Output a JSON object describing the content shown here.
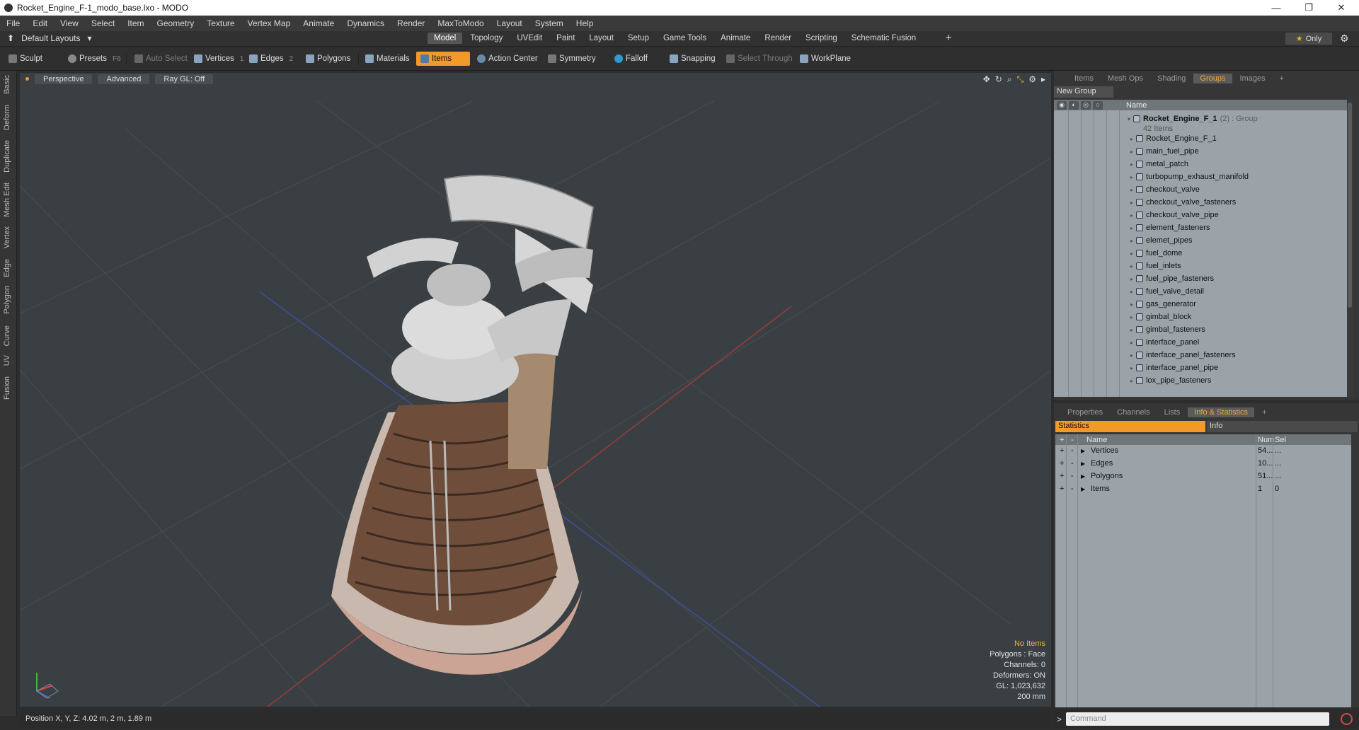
{
  "window": {
    "title": "Rocket_Engine_F-1_modo_base.lxo - MODO",
    "controls": [
      "—",
      "❐",
      "✕"
    ]
  },
  "menubar": [
    "File",
    "Edit",
    "View",
    "Select",
    "Item",
    "Geometry",
    "Texture",
    "Vertex Map",
    "Animate",
    "Dynamics",
    "Render",
    "MaxToModo",
    "Layout",
    "System",
    "Help"
  ],
  "layoutbar": {
    "layouts_label": "Default Layouts",
    "tabs": [
      "Model",
      "Topology",
      "UVEdit",
      "Paint",
      "Layout",
      "Setup",
      "Game Tools",
      "Animate",
      "Render",
      "Scripting",
      "Schematic Fusion"
    ],
    "active_tab": "Model",
    "plus": "+",
    "only_label": "Only"
  },
  "toolbar": {
    "sculpt": "Sculpt",
    "presets": "Presets",
    "presets_key": "F6",
    "auto_select": "Auto Select",
    "vertices": "Vertices",
    "vertices_key": "1",
    "edges": "Edges",
    "edges_key": "2",
    "polygons": "Polygons",
    "materials": "Materials",
    "items": "Items",
    "action_center": "Action Center",
    "symmetry": "Symmetry",
    "falloff": "Falloff",
    "snapping": "Snapping",
    "select_through": "Select Through",
    "workplane": "WorkPlane"
  },
  "left_tabs": [
    "Basic",
    "Deform",
    "Duplicate",
    "Mesh Edit",
    "Vertex",
    "Edge",
    "Polygon",
    "Curve",
    "UV",
    "Fusion"
  ],
  "viewport": {
    "view_mode": "Perspective",
    "shading": "Advanced",
    "raygl": "Ray GL: Off",
    "stats": {
      "no_items": "No Items",
      "polygons": "Polygons : Face",
      "channels": "Channels: 0",
      "deformers": "Deformers: ON",
      "gl": "GL: 1,023,632",
      "grid": "200 mm"
    }
  },
  "statusbar": {
    "position": "Position X, Y, Z:   4.02 m, 2 m, 1.89 m"
  },
  "groups_panel": {
    "tabs": [
      "Items",
      "Mesh Ops",
      "Shading",
      "Groups",
      "Images"
    ],
    "active_tab": "Groups",
    "new_group": "New Group",
    "column_name": "Name",
    "group": {
      "name": "Rocket_Engine_F_1",
      "count": "(2)",
      "type": ": Group",
      "items_count": "42 Items"
    },
    "items": [
      "Rocket_Engine_F_1",
      "main_fuel_pipe",
      "metal_patch",
      "turbopump_exhaust_manifold",
      "checkout_valve",
      "checkout_valve_fasteners",
      "checkout_valve_pipe",
      "element_fasteners",
      "elemet_pipes",
      "fuel_dome",
      "fuel_inlets",
      "fuel_pipe_fasteners",
      "fuel_valve_detail",
      "gas_generator",
      "gimbal_block",
      "gimbal_fasteners",
      "interface_panel",
      "interface_panel_fasteners",
      "interface_panel_pipe",
      "lox_pipe_fasteners"
    ]
  },
  "info_panel": {
    "tabs": [
      "Properties",
      "Channels",
      "Lists",
      "Info & Statistics"
    ],
    "active_tab": "Info & Statistics",
    "statistics_tab": "Statistics",
    "info_tab": "Info",
    "columns": {
      "name": "Name",
      "num": "Num",
      "sel": "Sel"
    },
    "rows": [
      {
        "name": "Vertices",
        "num": "54...",
        "sel": "..."
      },
      {
        "name": "Edges",
        "num": "10...",
        "sel": "..."
      },
      {
        "name": "Polygons",
        "num": "51...",
        "sel": "..."
      },
      {
        "name": "Items",
        "num": "1",
        "sel": "0"
      }
    ]
  },
  "command": {
    "prompt": ">",
    "placeholder": "Command"
  },
  "colors": {
    "accent": "#f29a25",
    "viewport_bg": "#3a3f43",
    "panel_bg": "#9ba3a8"
  }
}
